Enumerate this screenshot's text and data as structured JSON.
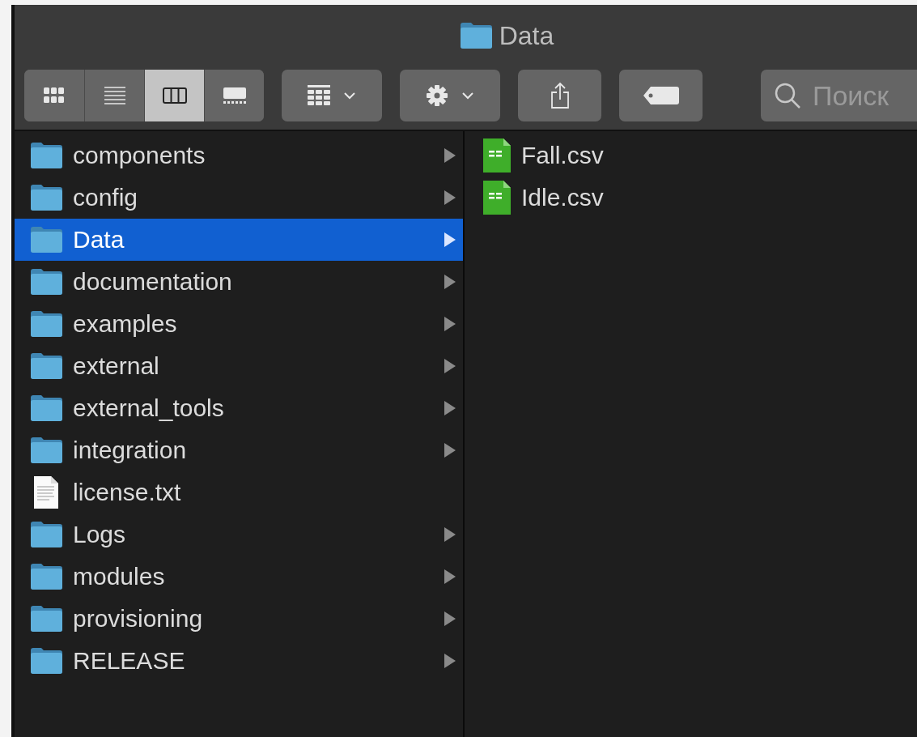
{
  "window": {
    "title": "Data"
  },
  "view_modes": [
    {
      "kind": "icons",
      "selected": false
    },
    {
      "kind": "list",
      "selected": false
    },
    {
      "kind": "columns",
      "selected": true
    },
    {
      "kind": "gallery",
      "selected": false
    }
  ],
  "toolbar": [
    {
      "kind": "group",
      "dropdown": true
    },
    {
      "kind": "action",
      "dropdown": true
    },
    {
      "kind": "share",
      "dropdown": false
    },
    {
      "kind": "tag",
      "dropdown": false
    }
  ],
  "search": {
    "placeholder": "Поиск"
  },
  "columns": [
    {
      "items": [
        {
          "name": "components",
          "kind": "folder",
          "selected": false
        },
        {
          "name": "config",
          "kind": "folder",
          "selected": false
        },
        {
          "name": "Data",
          "kind": "folder",
          "selected": true
        },
        {
          "name": "documentation",
          "kind": "folder",
          "selected": false
        },
        {
          "name": "examples",
          "kind": "folder",
          "selected": false
        },
        {
          "name": "external",
          "kind": "folder",
          "selected": false
        },
        {
          "name": "external_tools",
          "kind": "folder",
          "selected": false
        },
        {
          "name": "integration",
          "kind": "folder",
          "selected": false
        },
        {
          "name": "license.txt",
          "kind": "text",
          "selected": false
        },
        {
          "name": "Logs",
          "kind": "folder",
          "selected": false
        },
        {
          "name": "modules",
          "kind": "folder",
          "selected": false
        },
        {
          "name": "provisioning",
          "kind": "folder",
          "selected": false
        },
        {
          "name": "RELEASE",
          "kind": "folder",
          "selected": false
        }
      ]
    },
    {
      "items": [
        {
          "name": "Fall.csv",
          "kind": "csv",
          "selected": false
        },
        {
          "name": "Idle.csv",
          "kind": "csv",
          "selected": false
        }
      ]
    }
  ]
}
